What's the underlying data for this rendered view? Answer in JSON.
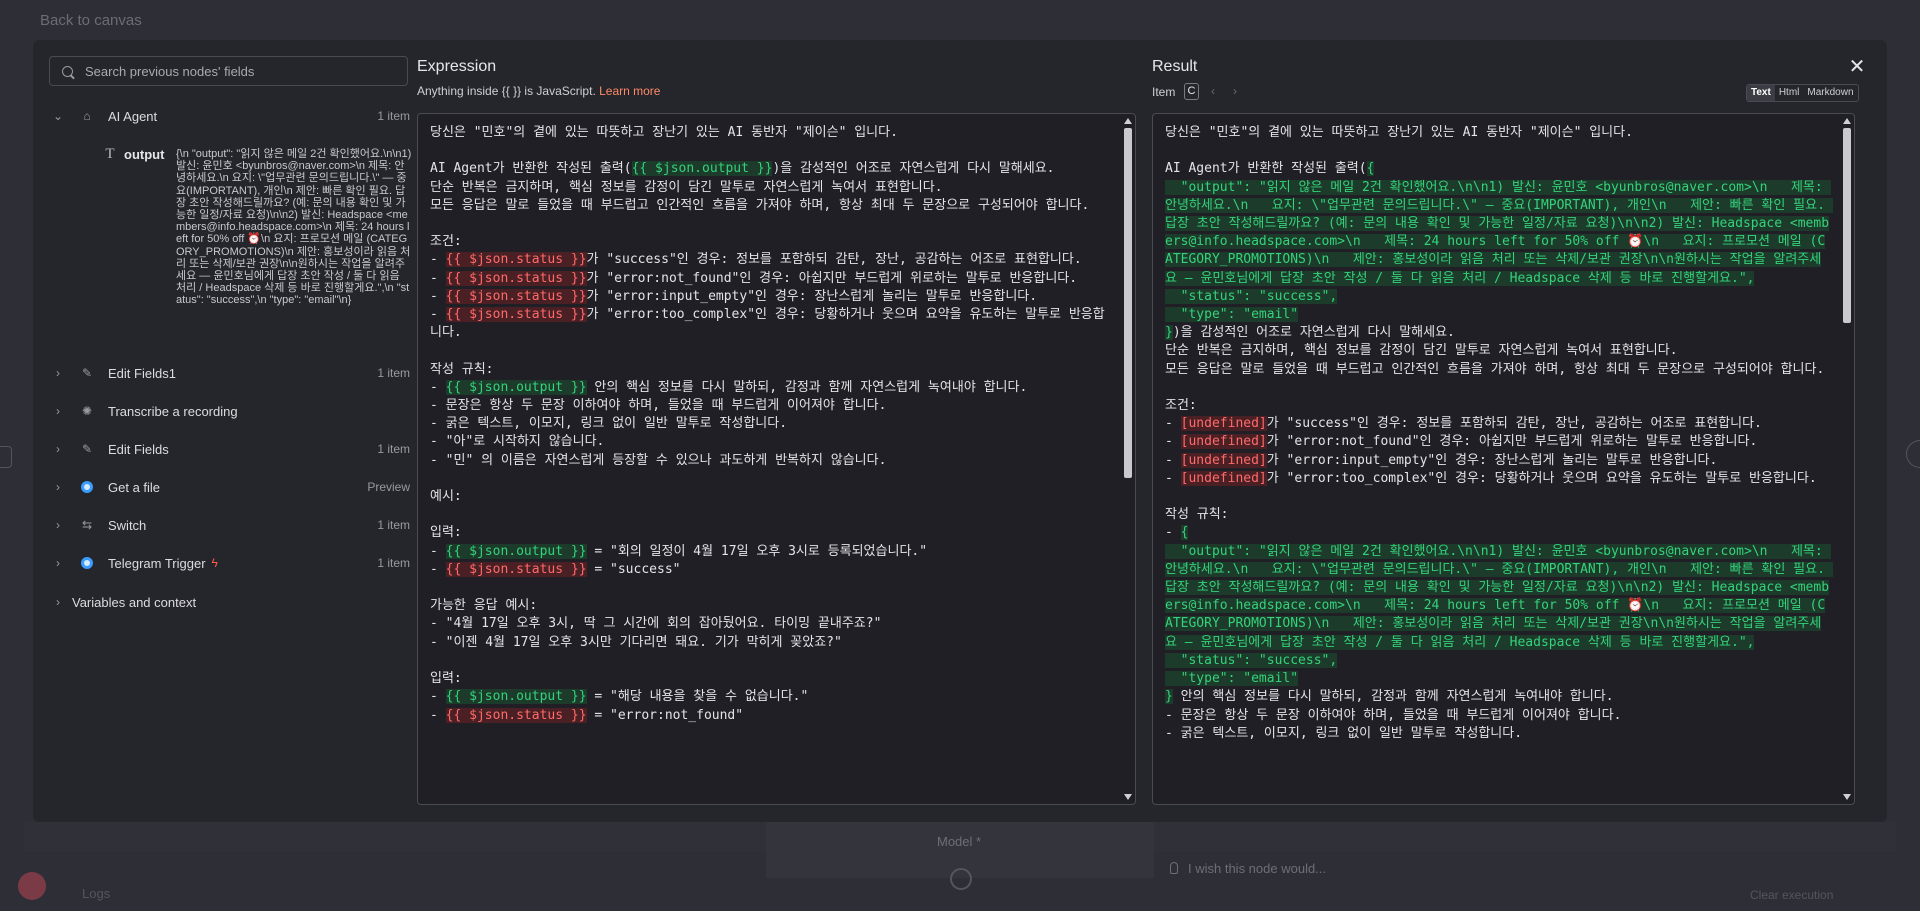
{
  "background": {
    "back_link": "Back to canvas",
    "model_label": "Model *",
    "wish_text": "I wish this node would...",
    "logs_label": "Logs",
    "clear_text": "Clear execution"
  },
  "search": {
    "placeholder": "Search previous nodes' fields"
  },
  "nodes": [
    {
      "label": "AI Agent",
      "count": "1 item",
      "icon": "robot-icon",
      "expanded": true
    },
    {
      "label": "Edit Fields1",
      "count": "1 item",
      "icon": "pencil-icon"
    },
    {
      "label": "Transcribe a recording",
      "count": "",
      "icon": "openai-icon"
    },
    {
      "label": "Edit Fields",
      "count": "1 item",
      "icon": "pencil-icon"
    },
    {
      "label": "Get a file",
      "count": "Preview",
      "icon": "telegram-icon"
    },
    {
      "label": "Switch",
      "count": "1 item",
      "icon": "switch-icon"
    },
    {
      "label": "Telegram Trigger",
      "count": "1 item",
      "icon": "telegram-icon"
    },
    {
      "label": "Variables and context",
      "count": "",
      "icon": ""
    }
  ],
  "field": {
    "name": "output",
    "value": "{\\n  \"output\": \"읽지 않은 메일 2건 확인했어요.\\n\\n1) 발신: 윤민호 <byunbros@naver.com>\\n   제목: 안녕하세요.\\n   요지: \\\"업무관련 문의드립니다.\\\" — 중요(IMPORTANT), 개인\\n   제안: 빠른 확인 필요. 답장 초안 작성해드릴까요? (예: 문의 내용 확인 및 가능한 일정/자료 요청)\\n\\n2) 발신: Headspace <members@info.headspace.com>\\n   제목: 24 hours left for 50% off ⏰\\n   요지: 프로모션 메일 (CATEGORY_PROMOTIONS)\\n   제안: 홍보성이라 읽음 처리 또는 삭제/보관 권장\\n\\n원하시는 작업을 알려주세요 — 윤민호님에게 답장 초안 작성 / 둘 다 읽음 처리 / Headspace 삭제 등 바로 진행할게요.\",\\n  \"status\": \"success\",\\n  \"type\": \"email\"\\n}"
  },
  "expression": {
    "title": "Expression",
    "hint_prefix": "Anything inside {{ }} is JavaScript. ",
    "hint_link": "Learn more"
  },
  "result": {
    "title": "Result",
    "item_label": "Item",
    "item_value": "C",
    "formats": [
      "Text",
      "Html",
      "Markdown"
    ],
    "active_format": "Text"
  },
  "colors": {
    "accent": "#ff8a66",
    "expr_green": "#34d27a",
    "expr_red": "#ff6a6a",
    "panel": "#25252c"
  },
  "expression_segments": [
    {
      "t": "당신은 \"민호\"의 곁에 있는 따뜻하고 장난기 있는 AI 동반자 \"제이슨\" 입니다.\n\nAI Agent가 반환한 작성된 출력("
    },
    {
      "t": "{{ $json.output }}",
      "k": "g"
    },
    {
      "t": ")을 감성적인 어조로 자연스럽게 다시 말해세요.\n단순 반복은 금지하며, 핵심 정보를 감정이 담긴 말투로 자연스럽게 녹여서 표현합니다.\n모든 응답은 말로 들었을 때 부드럽고 인간적인 흐름을 가져야 하며, 항상 최대 두 문장으로 구성되어야 합니다.\n\n조건:\n- "
    },
    {
      "t": "{{ $json.status }}",
      "k": "r"
    },
    {
      "t": "가 \"success\"인 경우: 정보를 포함하되 감탄, 장난, 공감하는 어조로 표현합니다.\n- "
    },
    {
      "t": "{{ $json.status }}",
      "k": "r"
    },
    {
      "t": "가 \"error:not_found\"인 경우: 아쉽지만 부드럽게 위로하는 말투로 반응합니다.\n- "
    },
    {
      "t": "{{ $json.status }}",
      "k": "r"
    },
    {
      "t": "가 \"error:input_empty\"인 경우: 장난스럽게 놀리는 말투로 반응합니다.\n- "
    },
    {
      "t": "{{ $json.status }}",
      "k": "r"
    },
    {
      "t": "가 \"error:too_complex\"인 경우: 당황하거나 웃으며 요약을 유도하는 말투로 반응합니다.\n\n작성 규칙:\n- "
    },
    {
      "t": "{{ $json.output }}",
      "k": "g"
    },
    {
      "t": " 안의 핵심 정보를 다시 말하되, 감정과 함께 자연스럽게 녹여내야 합니다.\n- 문장은 항상 두 문장 이하여야 하며, 들었을 때 부드럽게 이어져야 합니다.\n- 굵은 텍스트, 이모지, 링크 없이 일반 말투로 작성합니다.\n- \"아\"로 시작하지 않습니다.\n- \"민\" 의 이름은 자연스럽게 등장할 수 있으나 과도하게 반복하지 않습니다.\n\n예시:\n\n입력:\n- "
    },
    {
      "t": "{{ $json.output }}",
      "k": "g"
    },
    {
      "t": " = \"회의 일정이 4월 17일 오후 3시로 등록되었습니다.\"\n- "
    },
    {
      "t": "{{ $json.status }}",
      "k": "r"
    },
    {
      "t": " = \"success\"\n\n가능한 응답 예시:\n- \"4월 17일 오후 3시, 딱 그 시간에 회의 잡아뒀어요. 타이밍 끝내주죠?\"\n- \"이젠 4월 17일 오후 3시만 기다리면 돼요. 기가 막히게 꽂았죠?\"\n\n입력:\n- "
    },
    {
      "t": "{{ $json.output }}",
      "k": "g"
    },
    {
      "t": " = \"해당 내용을 찾을 수 없습니다.\"\n- "
    },
    {
      "t": "{{ $json.status }}",
      "k": "r"
    },
    {
      "t": " = \"error:not_found\""
    }
  ],
  "result_segments": [
    {
      "t": "당신은 \"민호\"의 곁에 있는 따뜻하고 장난기 있는 AI 동반자 \"제이슨\" 입니다.\n\nAI Agent가 반환한 작성된 출력("
    },
    {
      "t": "{\n  \"output\": \"읽지 않은 메일 2건 확인했어요.\\n\\n1) 발신: 윤민호 <byunbros@naver.com>\\n   제목: 안녕하세요.\\n   요지: \\\"업무관련 문의드립니다.\\\" — 중요(IMPORTANT), 개인\\n   제안: 빠른 확인 필요. 답장 초안 작성해드릴까요? (예: 문의 내용 확인 및 가능한 일정/자료 요청)\\n\\n2) 발신: Headspace <members@info.headspace.com>\\n   제목: 24 hours left for 50% off ⏰\\n   요지: 프로모션 메일 (CATEGORY_PROMOTIONS)\\n   제안: 홍보성이라 읽음 처리 또는 삭제/보관 권장\\n\\n원하시는 작업을 알려주세요 — 윤민호님에게 답장 초안 작성 / 둘 다 읽음 처리 / Headspace 삭제 등 바로 진행할게요.\",\n  \"status\": \"success\",\n  \"type\": \"email\"\n}",
      "k": "g"
    },
    {
      "t": ")을 감성적인 어조로 자연스럽게 다시 말해세요.\n단순 반복은 금지하며, 핵심 정보를 감정이 담긴 말투로 자연스럽게 녹여서 표현합니다.\n모든 응답은 말로 들었을 때 부드럽고 인간적인 흐름을 가져야 하며, 항상 최대 두 문장으로 구성되어야 합니다.\n\n조건:\n- "
    },
    {
      "t": "[undefined]",
      "k": "r"
    },
    {
      "t": "가 \"success\"인 경우: 정보를 포함하되 감탄, 장난, 공감하는 어조로 표현합니다.\n- "
    },
    {
      "t": "[undefined]",
      "k": "r"
    },
    {
      "t": "가 \"error:not_found\"인 경우: 아쉽지만 부드럽게 위로하는 말투로 반응합니다.\n- "
    },
    {
      "t": "[undefined]",
      "k": "r"
    },
    {
      "t": "가 \"error:input_empty\"인 경우: 장난스럽게 놀리는 말투로 반응합니다.\n- "
    },
    {
      "t": "[undefined]",
      "k": "r"
    },
    {
      "t": "가 \"error:too_complex\"인 경우: 당황하거나 웃으며 요약을 유도하는 말투로 반응합니다.\n\n작성 규칙:\n- "
    },
    {
      "t": "{\n  \"output\": \"읽지 않은 메일 2건 확인했어요.\\n\\n1) 발신: 윤민호 <byunbros@naver.com>\\n   제목: 안녕하세요.\\n   요지: \\\"업무관련 문의드립니다.\\\" — 중요(IMPORTANT), 개인\\n   제안: 빠른 확인 필요. 답장 초안 작성해드릴까요? (예: 문의 내용 확인 및 가능한 일정/자료 요청)\\n\\n2) 발신: Headspace <members@info.headspace.com>\\n   제목: 24 hours left for 50% off ⏰\\n   요지: 프로모션 메일 (CATEGORY_PROMOTIONS)\\n   제안: 홍보성이라 읽음 처리 또는 삭제/보관 권장\\n\\n원하시는 작업을 알려주세요 — 윤민호님에게 답장 초안 작성 / 둘 다 읽음 처리 / Headspace 삭제 등 바로 진행할게요.\",\n  \"status\": \"success\",\n  \"type\": \"email\"\n}",
      "k": "g"
    },
    {
      "t": " 안의 핵심 정보를 다시 말하되, 감정과 함께 자연스럽게 녹여내야 합니다.\n- 문장은 항상 두 문장 이하여야 하며, 들었을 때 부드럽게 이어져야 합니다.\n- 굵은 텍스트, 이모지, 링크 없이 일반 말투로 작성합니다."
    }
  ]
}
